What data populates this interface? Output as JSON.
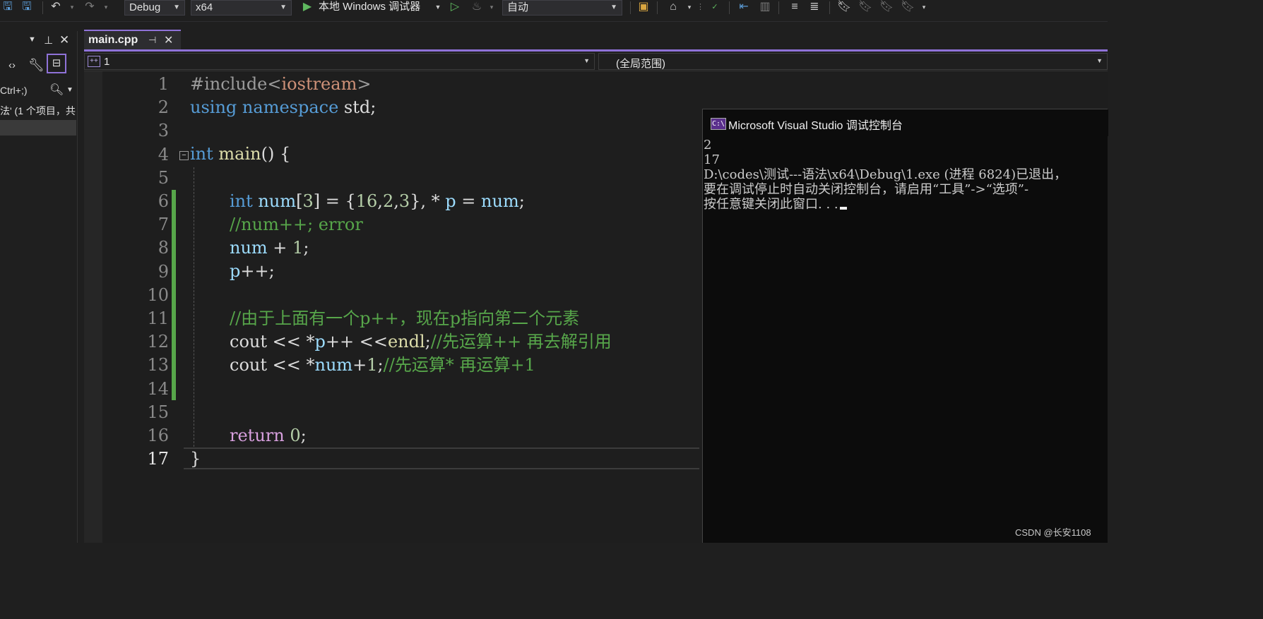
{
  "toolbar": {
    "config": "Debug",
    "platform": "x64",
    "run_label": "本地 Windows 调试器",
    "solution_config": "自动",
    "icons": [
      "save-icon",
      "save-all-icon",
      "undo-icon",
      "redo-icon",
      "play-icon",
      "start-without-debug-icon",
      "hot-reload-icon",
      "open-folder-icon",
      "navigate-icon",
      "spell-check-icon",
      "indent-icon",
      "comment-icon",
      "bookmark-icon"
    ]
  },
  "left_panel": {
    "search_hint": "Ctrl+;)",
    "item": "法' (1 个项目，共"
  },
  "tab": {
    "name": "main.cpp",
    "pin": "ᆍ",
    "close": "✕"
  },
  "navbar": {
    "project": "1",
    "scope": "(全局范围)"
  },
  "editor": {
    "line_numbers": [
      "1",
      "2",
      "3",
      "4",
      "5",
      "6",
      "7",
      "8",
      "9",
      "10",
      "11",
      "12",
      "13",
      "14",
      "15",
      "16",
      "17"
    ],
    "current_line": "17",
    "lines": {
      "l1_pp": "#include",
      "l1_lt": "<",
      "l1_hdr": "iostream",
      "l1_gt": ">",
      "l2_kw1": "using",
      "l2_kw2": "namespace",
      "l2_std": "std;",
      "l4_int": "int",
      "l4_main": "main",
      "l4_rest": "() {",
      "l6_int": "int",
      "l6_num": "num",
      "l6_a": "[",
      "l6_3": "3",
      "l6_b": "] = {",
      "l6_16": "16",
      "l6_c1": ",",
      "l6_2": "2",
      "l6_c2": ",",
      "l6_3b": "3",
      "l6_d": "}, * ",
      "l6_p": "p",
      "l6_eq": " = ",
      "l6_num2": "num",
      "l6_semi": ";",
      "l7": "//num++; error",
      "l8_num": "num",
      "l8_plus": " + ",
      "l8_1": "1",
      "l8_semi": ";",
      "l9_p": "p",
      "l9_rest": "++;",
      "l11": "//由于上面有一个p++，现在p指向第二个元素",
      "l12_cout": "cout",
      "l12_op": " << *",
      "l12_p": "p",
      "l12_op2": "++ <<",
      "l12_endl": "endl",
      "l12_semi": ";",
      "l12_cm": "//先运算++ 再去解引用",
      "l13_cout": "cout",
      "l13_op": " << *",
      "l13_num": "num",
      "l13_plus": "+",
      "l13_1": "1",
      "l13_semi": ";",
      "l13_cm": "//先运算* 再运算+1",
      "l16_ret": "return",
      "l16_0": "0",
      "l16_semi": ";",
      "l17": "}"
    }
  },
  "console": {
    "title": "Microsoft Visual Studio 调试控制台",
    "icon_text": "C:\\",
    "output": [
      "2",
      "17",
      "D:\\codes\\测试---语法\\x64\\Debug\\1.exe (进程 6824)已退出，",
      "要在调试停止时自动关闭控制台，请启用“工具”->“选项”-",
      "按任意键关闭此窗口. . ."
    ]
  },
  "watermark": "CSDN @长安1108",
  "colors": {
    "accent": "#8f72d8",
    "keyword": "#569cd6",
    "comment": "#57a64a",
    "change_bar": "#57a64a",
    "variable": "#9cdcfe"
  }
}
